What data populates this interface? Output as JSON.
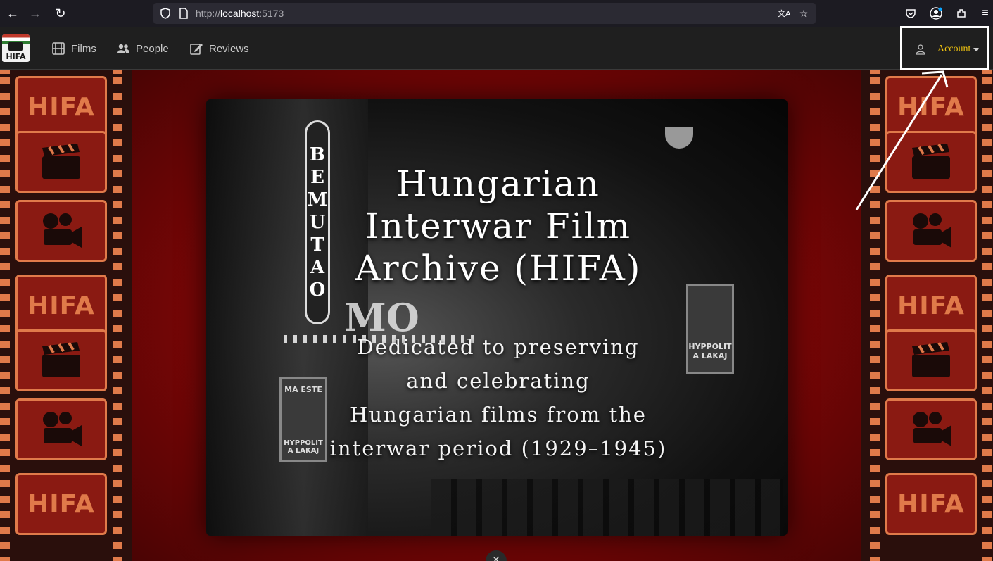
{
  "browser": {
    "url_prefix": "http://",
    "url_host": "localhost",
    "url_port": ":5173"
  },
  "app": {
    "logo_text": "HIFA",
    "nav": [
      {
        "label": "Films",
        "icon": "film-icon"
      },
      {
        "label": "People",
        "icon": "people-icon"
      },
      {
        "label": "Reviews",
        "icon": "edit-icon"
      }
    ],
    "account": {
      "label": "Account",
      "icon": "person-icon"
    }
  },
  "filmstrip": {
    "frame_text": "HIFA"
  },
  "hero": {
    "marquee_letters": [
      "B",
      "E",
      "M",
      "U",
      "T",
      "A",
      "O"
    ],
    "marquee_sign": "MO",
    "poster_left": "MA ESTE",
    "poster_left_bottom": "HYPPOLIT A LAKAJ",
    "poster_right": "HYPPOLIT A LAKAJ",
    "title_lines": [
      "Hungarian",
      "Interwar Film",
      "Archive (HIFA)"
    ],
    "subtitle_lines": [
      "Dedicated to preserving",
      "and celebrating",
      "Hungarian films from the",
      "interwar period (1929–1945)"
    ]
  },
  "colors": {
    "accent": "#f1c40f",
    "page_red": "#7a0a0a",
    "strip_orange": "#e07a4a"
  }
}
